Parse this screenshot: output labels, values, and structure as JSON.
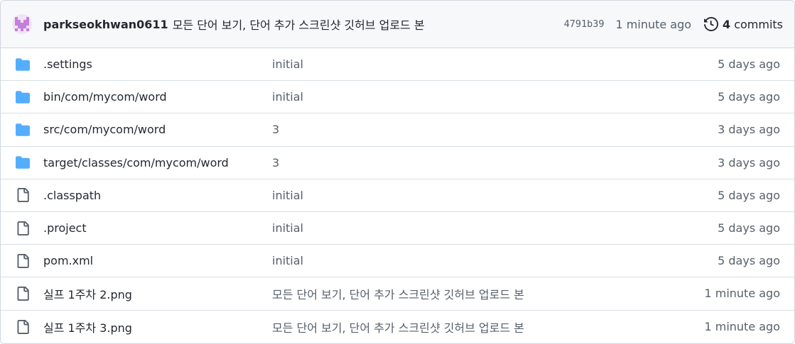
{
  "commit": {
    "author": "parkseokhwan0611",
    "message": "모든 단어 보기, 단어 추가 스크린샷 깃허브 업로드 본",
    "sha": "4791b39",
    "time": "1 minute ago",
    "commits_count": "4",
    "commits_label": "commits"
  },
  "colors": {
    "folder": "#54aeff",
    "file": "#57606a",
    "avatar": "#c47fdb"
  },
  "files": [
    {
      "type": "folder-icon",
      "name": ".settings",
      "message": "initial",
      "age": "5 days ago"
    },
    {
      "type": "folder-icon",
      "name": "bin/com/mycom/word",
      "message": "initial",
      "age": "5 days ago"
    },
    {
      "type": "folder-icon",
      "name": "src/com/mycom/word",
      "message": "3",
      "age": "3 days ago"
    },
    {
      "type": "folder-icon",
      "name": "target/classes/com/mycom/word",
      "message": "3",
      "age": "3 days ago"
    },
    {
      "type": "file-icon",
      "name": ".classpath",
      "message": "initial",
      "age": "5 days ago"
    },
    {
      "type": "file-icon",
      "name": ".project",
      "message": "initial",
      "age": "5 days ago"
    },
    {
      "type": "file-icon",
      "name": "pom.xml",
      "message": "initial",
      "age": "5 days ago"
    },
    {
      "type": "file-icon",
      "name": "실프 1주차 2.png",
      "message": "모든 단어 보기, 단어 추가 스크린샷 깃허브 업로드 본",
      "age": "1 minute ago"
    },
    {
      "type": "file-icon",
      "name": "실프 1주차 3.png",
      "message": "모든 단어 보기, 단어 추가 스크린샷 깃허브 업로드 본",
      "age": "1 minute ago"
    }
  ]
}
